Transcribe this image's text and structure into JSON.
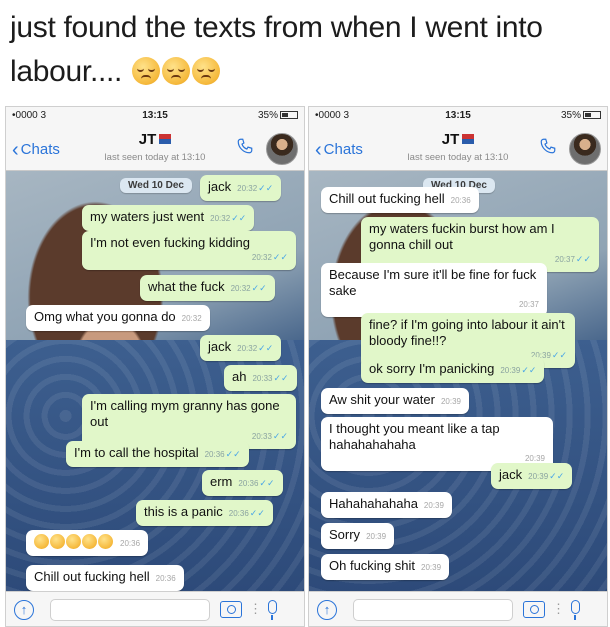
{
  "caption": {
    "text": "just found the texts from when I went into labour....",
    "emoji_count": 3,
    "emoji_icon": "disappointed-face-icon"
  },
  "left": {
    "status": {
      "carrier": "•0000 3",
      "time": "13:15",
      "battery": "35%"
    },
    "nav": {
      "back": "Chats",
      "name": "JT",
      "last_seen": "last seen today at 13:10"
    },
    "date": "Wed 10 Dec",
    "messages": [
      {
        "text": "jack",
        "time": "20:32",
        "dir": "out"
      },
      {
        "text": "my waters just went",
        "time": "20:32",
        "dir": "out"
      },
      {
        "text": "I'm not even fucking kidding",
        "time": "20:32",
        "dir": "out"
      },
      {
        "text": "what the fuck",
        "time": "20:32",
        "dir": "out"
      },
      {
        "text": "Omg what you gonna do",
        "time": "20:32",
        "dir": "in"
      },
      {
        "text": "jack",
        "time": "20:32",
        "dir": "out"
      },
      {
        "text": "ah",
        "time": "20:33",
        "dir": "out"
      },
      {
        "text": "I'm calling mym granny has gone out",
        "time": "20:33",
        "dir": "out"
      },
      {
        "text": "I'm to call the hospital",
        "time": "20:36",
        "dir": "out"
      },
      {
        "text": "erm",
        "time": "20:36",
        "dir": "out"
      },
      {
        "text": "this is a panic",
        "time": "20:36",
        "dir": "out"
      },
      {
        "text": "",
        "time": "20:36",
        "dir": "in",
        "emoji_count": 5
      },
      {
        "text": "Chill out fucking hell",
        "time": "20:36",
        "dir": "in"
      }
    ]
  },
  "right": {
    "status": {
      "carrier": "•0000 3",
      "time": "13:15",
      "battery": "35%"
    },
    "nav": {
      "back": "Chats",
      "name": "JT",
      "last_seen": "last seen today at 13:10"
    },
    "date": "Wed 10 Dec",
    "messages": [
      {
        "text": "Chill out fucking hell",
        "time": "20:36",
        "dir": "in"
      },
      {
        "text": "my waters fuckin burst how am I gonna chill out",
        "time": "20:37",
        "dir": "out"
      },
      {
        "text": "Because I'm sure it'll be fine for fuck sake",
        "time": "20:37",
        "dir": "in"
      },
      {
        "text": "fine? if I'm going into labour it ain't bloody fine!!?",
        "time": "20:39",
        "dir": "out"
      },
      {
        "text": "ok sorry I'm panicking",
        "time": "20:39",
        "dir": "out"
      },
      {
        "text": "Aw shit your water",
        "time": "20:39",
        "dir": "in"
      },
      {
        "text": "I thought you meant like a tap hahahahahaha",
        "time": "20:39",
        "dir": "in"
      },
      {
        "text": "jack",
        "time": "20:39",
        "dir": "out"
      },
      {
        "text": "Hahahahahaha",
        "time": "20:39",
        "dir": "in"
      },
      {
        "text": "Sorry",
        "time": "20:39",
        "dir": "in"
      },
      {
        "text": "Oh fucking shit",
        "time": "20:39",
        "dir": "in"
      }
    ]
  },
  "colors": {
    "outgoing_bubble": "#e1f7c9",
    "incoming_bubble": "#ffffff",
    "accent": "#2a74d9",
    "read_ticks": "#4aa6e6"
  }
}
